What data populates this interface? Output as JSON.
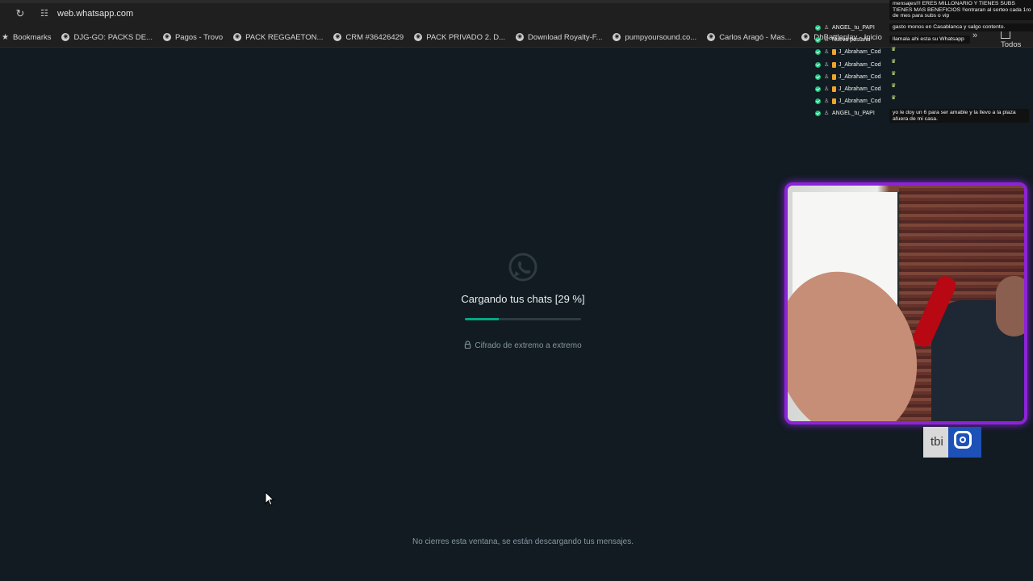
{
  "browser": {
    "url": "web.whatsapp.com",
    "bookmarks_label": "Bookmarks",
    "bookmarks": [
      "DJG-GO: PACKS DE...",
      "Pagos - Trovo",
      "PACK REGGAETON...",
      "CRM #36426429",
      "PACK PRIVADO 2. D...",
      "Download Royalty-F...",
      "pumpyoursound.co...",
      "Carlos Aragó - Mas...",
      "DbBattleplay - Inicio"
    ],
    "bookmarks_overflow": "Todos"
  },
  "whatsapp": {
    "loading_text": "Cargando tus chats [29 %]",
    "progress_percent": 29,
    "encryption_text": "Cifrado de extremo a extremo",
    "footer_text": "No cierres esta ventana, se están descargando tus mensajes."
  },
  "stream_overlay": {
    "users": [
      "ANGEL_tu_PAPI",
      "Nueva pestaña",
      "J_Abraham_Cod",
      "J_Abraham_Cod",
      "J_Abraham_Cod",
      "J_Abraham_Cod",
      "J_Abraham_Cod",
      "ANGEL_tu_PAPI"
    ],
    "messages": {
      "top": "mensajes!!! ERES MILLONARIO Y TIENES SUBS TIENES MAS BENEFICIOS !!entraran al sorteo cada 1ro de mes para subs o vip",
      "m2": "gasto monos en Casablanca y salgo contento.",
      "m3": "llamala ahi esta su Whatsapp",
      "m4": "yo le doy un 6 para ser amable y la llevo a la plaza afuera de mi casa."
    },
    "social_badge": "tbi",
    "social_icon": "instagram-icon",
    "accent_color": "#8e22d9"
  }
}
